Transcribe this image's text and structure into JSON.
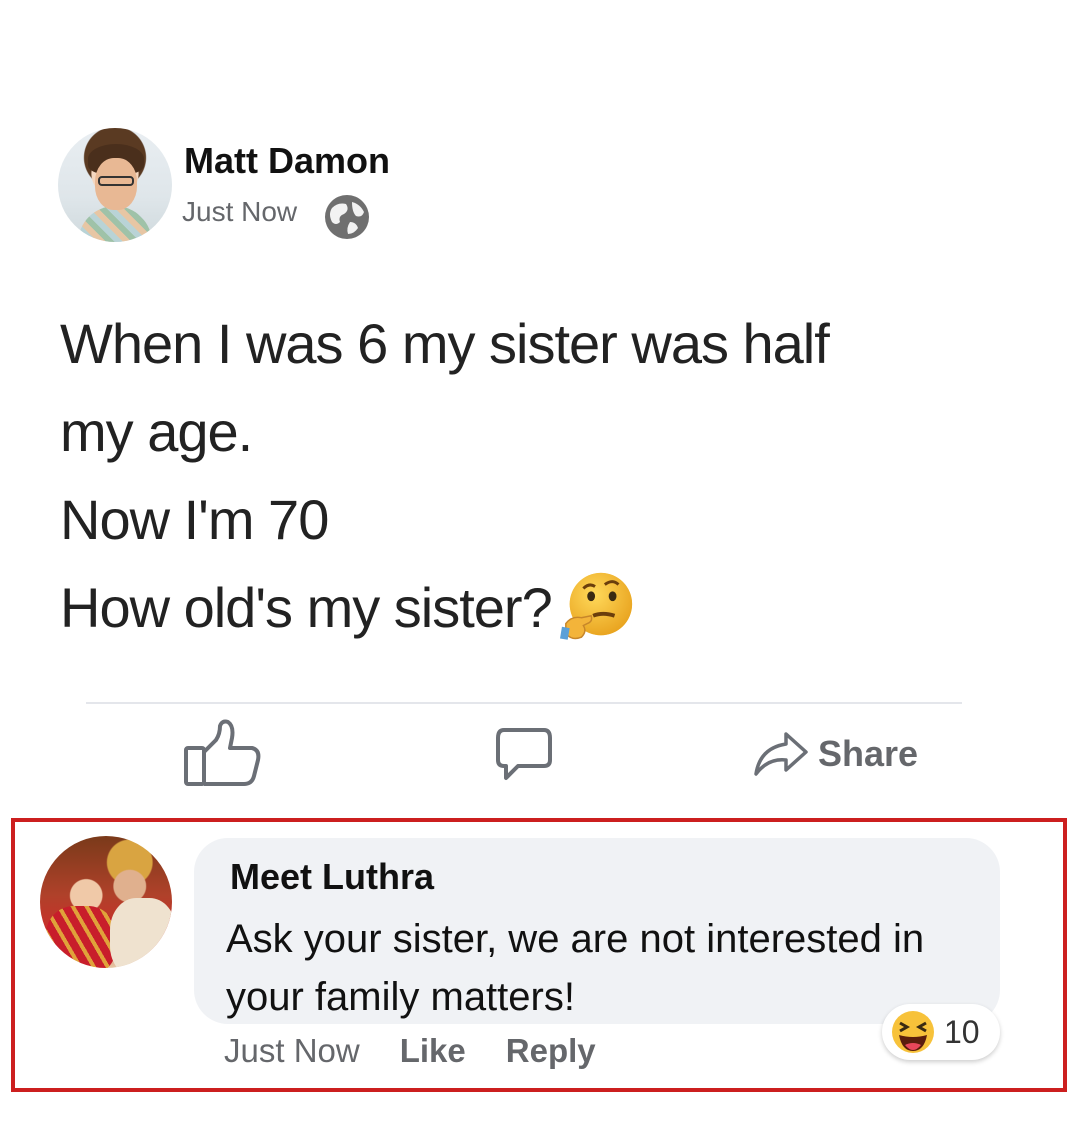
{
  "post": {
    "author": "Matt Damon",
    "timestamp": "Just Now",
    "privacy_icon": "globe-icon",
    "lines": [
      "When I was 6 my sister was half",
      "my age.",
      "Now I'm 70",
      "How old's my sister?"
    ],
    "emoji": "thinking-face-icon"
  },
  "actions": {
    "like_icon": "thumbs-up-icon",
    "comment_icon": "comment-icon",
    "share_label": "Share"
  },
  "comment": {
    "author": "Meet Luthra",
    "text_lines": [
      "Ask your sister, we are not interested in",
      "your family matters!"
    ],
    "timestamp": "Just Now",
    "like_label": "Like",
    "reply_label": "Reply",
    "reaction_icon": "haha-icon",
    "reaction_count": "10",
    "highlight_color": "#cc1f1f"
  }
}
